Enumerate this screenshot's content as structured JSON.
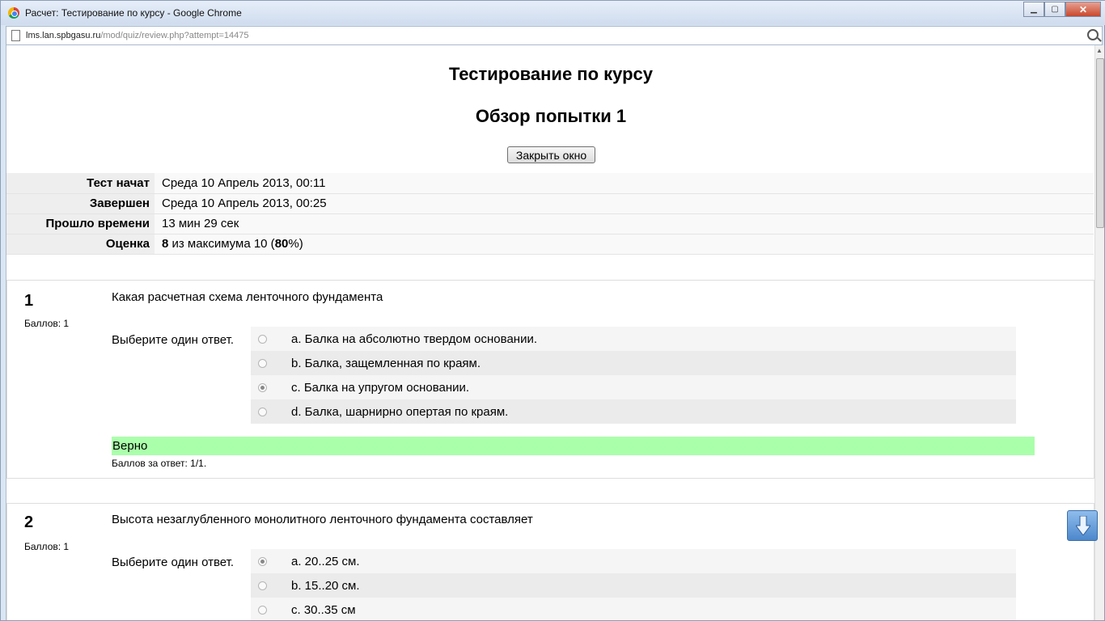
{
  "window": {
    "title": "Расчет: Тестирование по курсу - Google Chrome"
  },
  "address": {
    "host": "lms.lan.spbgasu.ru",
    "path": "/mod/quiz/review.php?attempt=14475"
  },
  "page": {
    "course_title": "Тестирование по курсу",
    "review_title": "Обзор попытки 1",
    "close_button": "Закрыть окно"
  },
  "summary": {
    "started_label": "Тест начат",
    "started_value": "Среда 10 Апрель 2013, 00:11",
    "completed_label": "Завершен",
    "completed_value": "Среда 10 Апрель 2013, 00:25",
    "time_label": "Прошло времени",
    "time_value": "13 мин 29 сек",
    "grade_label": "Оценка",
    "grade_score": "8",
    "grade_text_1": " из максимума 10 (",
    "grade_percent": "80",
    "grade_text_2": "%)"
  },
  "questions": [
    {
      "number": "1",
      "marks": "Баллов: 1",
      "text": "Какая расчетная схема ленточного фундамента",
      "prompt": "Выберите один ответ.",
      "answers": [
        {
          "label": "a. Балка на абсолютно твердом основании.",
          "checked": false
        },
        {
          "label": "b. Балка, защемленная по краям.",
          "checked": false
        },
        {
          "label": "c. Балка на упругом основании.",
          "checked": true
        },
        {
          "label": "d. Балка, шарнирно опертая по краям.",
          "checked": false
        }
      ],
      "outcome": "Верно",
      "grade": "Баллов за ответ: 1/1."
    },
    {
      "number": "2",
      "marks": "Баллов: 1",
      "text": "Высота незаглубленного монолитного ленточного фундамента составляет",
      "prompt": "Выберите один ответ.",
      "answers": [
        {
          "label": "a. 20..25 см.",
          "checked": true
        },
        {
          "label": "b. 15..20 см.",
          "checked": false
        },
        {
          "label": "c. 30..35 см",
          "checked": false
        }
      ]
    }
  ],
  "colors": {
    "correct": "#aaffaa"
  }
}
